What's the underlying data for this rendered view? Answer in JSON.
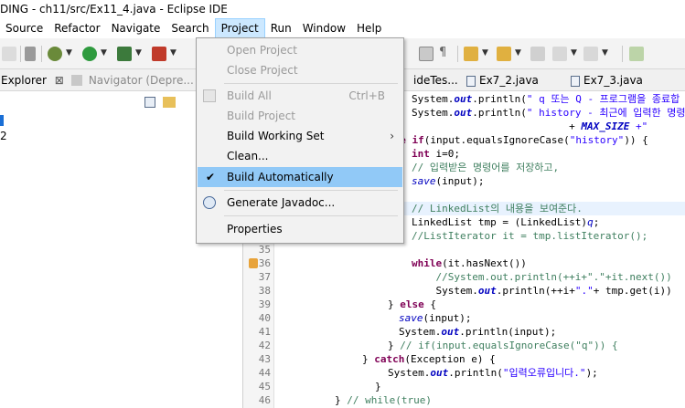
{
  "window": {
    "title": "DING - ch11/src/Ex11_4.java - Eclipse IDE"
  },
  "menubar": [
    "Source",
    "Refactor",
    "Navigate",
    "Search",
    "Project",
    "Run",
    "Window",
    "Help"
  ],
  "left_panel": {
    "tabs": [
      {
        "label": "Explorer",
        "close": "⊠"
      },
      {
        "label": "Navigator (Depre..."
      }
    ],
    "tree_partial_label": "2"
  },
  "editor_tabs": [
    "ideTes...",
    "Ex7_2.java",
    "Ex7_3.java"
  ],
  "project_menu": {
    "items": [
      {
        "label": "Open Project",
        "enabled": false
      },
      {
        "label": "Close Project",
        "enabled": false
      },
      {
        "label": "Build All",
        "accelerator": "Ctrl+B",
        "enabled": false,
        "icon": "build-all-icon"
      },
      {
        "label": "Build Project",
        "enabled": false
      },
      {
        "label": "Build Working Set",
        "enabled": true,
        "submenu": true
      },
      {
        "label": "Clean...",
        "enabled": true
      },
      {
        "label": "Build Automatically",
        "enabled": true,
        "checked": true,
        "selected": true
      },
      {
        "label": "Generate Javadoc...",
        "enabled": true,
        "icon": "javadoc-icon"
      },
      {
        "label": "Properties",
        "enabled": true
      }
    ],
    "check_glyph": "✔",
    "submenu_glyph": "›"
  },
  "code": {
    "lines": [
      {
        "n": "",
        "segments": [
          {
            "t": "System.",
            "c": ""
          },
          {
            "t": "out",
            "c": "itb"
          },
          {
            "t": ".println(",
            "c": ""
          },
          {
            "t": "\" q 또는 Q - 프로그램을 종료합",
            "c": "st"
          }
        ]
      },
      {
        "n": "",
        "segments": [
          {
            "t": "System.",
            "c": ""
          },
          {
            "t": "out",
            "c": "itb"
          },
          {
            "t": ".println(",
            "c": ""
          },
          {
            "t": "\" history - 최근에 입력한 명령",
            "c": "st"
          }
        ]
      },
      {
        "n": "",
        "segments": [
          {
            "t": "                          + ",
            "c": ""
          },
          {
            "t": "MAX_SIZE",
            "c": "itb"
          },
          {
            "t": " +\"",
            "c": "st"
          }
        ]
      },
      {
        "n": "",
        "segments": [
          {
            "t": "lse ",
            "c": "kw"
          },
          {
            "t": "if",
            "c": "kw"
          },
          {
            "t": "(input.equalsIgnoreCase(",
            "c": ""
          },
          {
            "t": "\"history\"",
            "c": "st"
          },
          {
            "t": ")) {",
            "c": ""
          }
        ]
      },
      {
        "n": "",
        "segments": [
          {
            "t": "int",
            "c": "kw"
          },
          {
            "t": " i=0;",
            "c": ""
          }
        ]
      },
      {
        "n": "",
        "segments": [
          {
            "t": "// 입력받은 명령어를 저장하고,",
            "c": "cm"
          }
        ]
      },
      {
        "n": "",
        "segments": [
          {
            "t": "save",
            "c": "it"
          },
          {
            "t": "(input);",
            "c": ""
          }
        ]
      },
      {
        "n": "",
        "segments": [
          {
            "t": "",
            "c": ""
          }
        ]
      },
      {
        "n": "",
        "segments": [
          {
            "t": "// LinkedList의 내용을 보여준다.",
            "c": "cm"
          }
        ],
        "highlight": true
      },
      {
        "n": "",
        "segments": [
          {
            "t": "LinkedList tmp = (LinkedList)",
            "c": ""
          },
          {
            "t": "q",
            "c": "it"
          },
          {
            "t": ";",
            "c": ""
          }
        ]
      },
      {
        "n": "",
        "segments": [
          {
            "t": "//ListIterator it = tmp.listIterator();",
            "c": "cm"
          }
        ]
      },
      {
        "n": "35",
        "segments": [
          {
            "t": "",
            "c": ""
          }
        ]
      },
      {
        "n": "36",
        "segments": [
          {
            "t": "while",
            "c": "kw"
          },
          {
            "t": "(it.hasNext())",
            "c": ""
          }
        ],
        "warn": true
      },
      {
        "n": "37",
        "segments": [
          {
            "t": "    //System.out.println(++i+\".\"+it.next())",
            "c": "cm"
          }
        ]
      },
      {
        "n": "38",
        "segments": [
          {
            "t": "    System.",
            "c": ""
          },
          {
            "t": "out",
            "c": "itb"
          },
          {
            "t": ".println(++i+",
            "c": ""
          },
          {
            "t": "\".\"",
            "c": "st"
          },
          {
            "t": "+ tmp.get(i))",
            "c": ""
          }
        ]
      },
      {
        "n": "39",
        "segments": [
          {
            "t": "} ",
            "c": ""
          },
          {
            "t": "else",
            "c": "kw"
          },
          {
            "t": " {",
            "c": ""
          }
        ]
      },
      {
        "n": "40",
        "segments": [
          {
            "t": "save",
            "c": "it"
          },
          {
            "t": "(input);",
            "c": ""
          }
        ]
      },
      {
        "n": "41",
        "segments": [
          {
            "t": "System.",
            "c": ""
          },
          {
            "t": "out",
            "c": "itb"
          },
          {
            "t": ".println(input);",
            "c": ""
          }
        ]
      },
      {
        "n": "42",
        "segments": [
          {
            "t": "} ",
            "c": ""
          },
          {
            "t": "// if(input.equalsIgnoreCase(\"q\")) {",
            "c": "cm"
          }
        ]
      },
      {
        "n": "43",
        "segments": [
          {
            "t": "} ",
            "c": ""
          },
          {
            "t": "catch",
            "c": "kw"
          },
          {
            "t": "(Exception e) {",
            "c": ""
          }
        ]
      },
      {
        "n": "44",
        "segments": [
          {
            "t": "System.",
            "c": ""
          },
          {
            "t": "out",
            "c": "itb"
          },
          {
            "t": ".println(",
            "c": ""
          },
          {
            "t": "\"입력오류입니다.\"",
            "c": "st"
          },
          {
            "t": ");",
            "c": ""
          }
        ]
      },
      {
        "n": "45",
        "segments": [
          {
            "t": "}",
            "c": ""
          }
        ]
      },
      {
        "n": "46",
        "segments": [
          {
            "t": "} ",
            "c": ""
          },
          {
            "t": "// while(true)",
            "c": "cm"
          }
        ]
      }
    ]
  }
}
